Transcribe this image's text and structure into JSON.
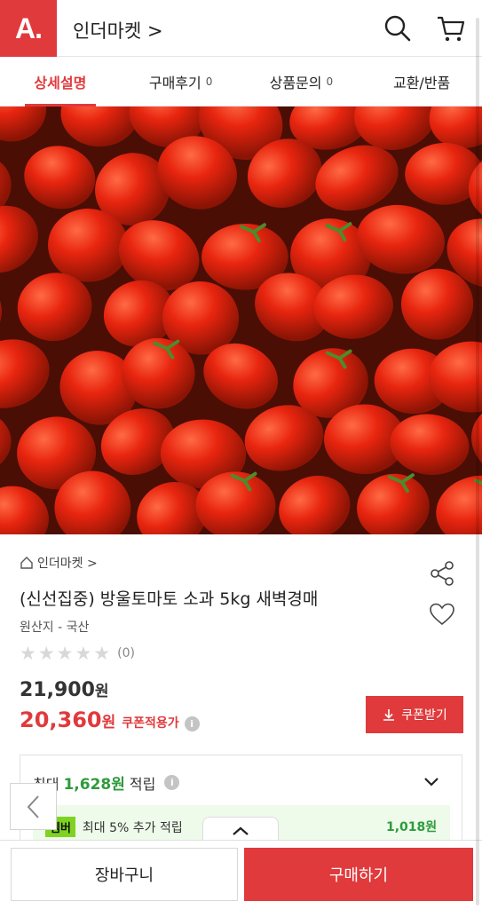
{
  "header": {
    "logo_text": "A.",
    "store_title": "인더마켓 >"
  },
  "tabs": [
    {
      "label": "상세설명",
      "count": ""
    },
    {
      "label": "구매후기",
      "count": "0"
    },
    {
      "label": "상품문의",
      "count": "0"
    },
    {
      "label": "교환/반품",
      "count": ""
    }
  ],
  "product": {
    "breadcrumb": "인더마켓 >",
    "name": "(신선집중) 방울토마토 소과 5kg 새벽경매",
    "origin": "원산지 - 국산",
    "review_count": "(0)",
    "rating": 0,
    "price": "21,900",
    "coupon_price": "20,360",
    "currency": "원",
    "coupon_label": "쿠폰적용가",
    "coupon_button": "쿠폰받기"
  },
  "points": {
    "prefix": "최대",
    "amount": "1,628원",
    "suffix": "적립",
    "member_logo": "멤버",
    "member_text": "최대 5% 추가 적립",
    "member_amount": "1,018원"
  },
  "bottom": {
    "cart_label": "장바구니",
    "buy_label": "구매하기"
  },
  "colors": {
    "accent": "#e03a3c",
    "green": "#2e9b3c"
  }
}
